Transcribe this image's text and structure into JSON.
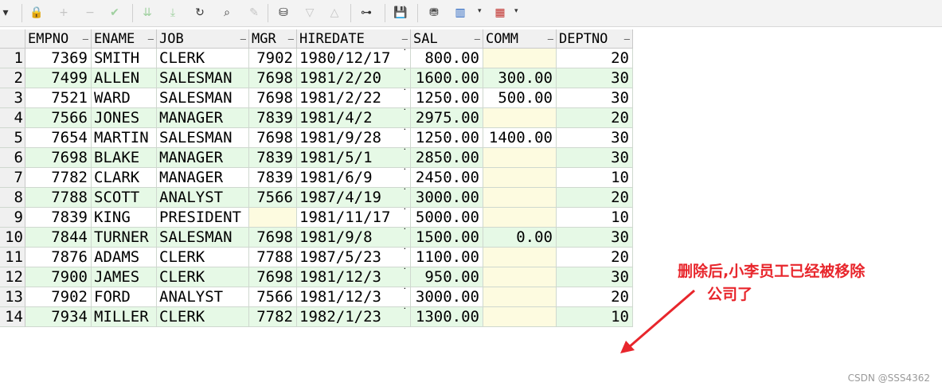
{
  "toolbar": {
    "icons": [
      {
        "name": "dropdown-caret-icon",
        "glyph": "▾",
        "state": "normal"
      },
      {
        "name": "lock-icon",
        "glyph": "🔒",
        "state": "normal"
      },
      {
        "name": "add-record-icon",
        "glyph": "+",
        "state": "disabled"
      },
      {
        "name": "delete-record-icon",
        "glyph": "−",
        "state": "disabled"
      },
      {
        "name": "post-changes-icon",
        "glyph": "✔",
        "state": "disabled-green"
      },
      {
        "name": "fetch-next-icon",
        "glyph": "⇊",
        "state": "disabled-green"
      },
      {
        "name": "fetch-last-icon",
        "glyph": "⤓",
        "state": "disabled-green"
      },
      {
        "name": "refresh-icon",
        "glyph": "↻",
        "state": "normal"
      },
      {
        "name": "find-icon",
        "glyph": "⌕",
        "state": "normal"
      },
      {
        "name": "clear-icon",
        "glyph": "✎",
        "state": "disabled"
      },
      {
        "name": "query-by-example-icon",
        "glyph": "⛁",
        "state": "normal"
      },
      {
        "name": "sort-descending-icon",
        "glyph": "▽",
        "state": "disabled"
      },
      {
        "name": "sort-ascending-icon",
        "glyph": "△",
        "state": "disabled"
      },
      {
        "name": "tree-view-icon",
        "glyph": "⊶",
        "state": "normal"
      },
      {
        "name": "save-icon",
        "glyph": "💾",
        "state": "normal"
      },
      {
        "name": "database-icon",
        "glyph": "⛃",
        "state": "normal"
      },
      {
        "name": "chart-icon",
        "glyph": "▥",
        "state": "normal"
      },
      {
        "name": "grid-view-icon",
        "glyph": "▦",
        "state": "normal"
      }
    ],
    "colors": {
      "background": "#f3f3f3",
      "green": "#3a9b3a"
    }
  },
  "grid": {
    "columns": [
      "EMPNO",
      "ENAME",
      "JOB",
      "MGR",
      "HIREDATE",
      "SAL",
      "COMM",
      "DEPTNO"
    ],
    "rows": [
      {
        "n": "1",
        "empno": "7369",
        "ename": "SMITH",
        "job": "CLERK",
        "mgr": "7902",
        "hiredate": "1980/12/17",
        "sal": "800.00",
        "comm": "",
        "deptno": "20"
      },
      {
        "n": "2",
        "empno": "7499",
        "ename": "ALLEN",
        "job": "SALESMAN",
        "mgr": "7698",
        "hiredate": "1981/2/20",
        "sal": "1600.00",
        "comm": "300.00",
        "deptno": "30"
      },
      {
        "n": "3",
        "empno": "7521",
        "ename": "WARD",
        "job": "SALESMAN",
        "mgr": "7698",
        "hiredate": "1981/2/22",
        "sal": "1250.00",
        "comm": "500.00",
        "deptno": "30"
      },
      {
        "n": "4",
        "empno": "7566",
        "ename": "JONES",
        "job": "MANAGER",
        "mgr": "7839",
        "hiredate": "1981/4/2",
        "sal": "2975.00",
        "comm": "",
        "deptno": "20"
      },
      {
        "n": "5",
        "empno": "7654",
        "ename": "MARTIN",
        "job": "SALESMAN",
        "mgr": "7698",
        "hiredate": "1981/9/28",
        "sal": "1250.00",
        "comm": "1400.00",
        "deptno": "30"
      },
      {
        "n": "6",
        "empno": "7698",
        "ename": "BLAKE",
        "job": "MANAGER",
        "mgr": "7839",
        "hiredate": "1981/5/1",
        "sal": "2850.00",
        "comm": "",
        "deptno": "30"
      },
      {
        "n": "7",
        "empno": "7782",
        "ename": "CLARK",
        "job": "MANAGER",
        "mgr": "7839",
        "hiredate": "1981/6/9",
        "sal": "2450.00",
        "comm": "",
        "deptno": "10"
      },
      {
        "n": "8",
        "empno": "7788",
        "ename": "SCOTT",
        "job": "ANALYST",
        "mgr": "7566",
        "hiredate": "1987/4/19",
        "sal": "3000.00",
        "comm": "",
        "deptno": "20"
      },
      {
        "n": "9",
        "empno": "7839",
        "ename": "KING",
        "job": "PRESIDENT",
        "mgr": "",
        "hiredate": "1981/11/17",
        "sal": "5000.00",
        "comm": "",
        "deptno": "10"
      },
      {
        "n": "10",
        "empno": "7844",
        "ename": "TURNER",
        "job": "SALESMAN",
        "mgr": "7698",
        "hiredate": "1981/9/8",
        "sal": "1500.00",
        "comm": "0.00",
        "deptno": "30"
      },
      {
        "n": "11",
        "empno": "7876",
        "ename": "ADAMS",
        "job": "CLERK",
        "mgr": "7788",
        "hiredate": "1987/5/23",
        "sal": "1100.00",
        "comm": "",
        "deptno": "20"
      },
      {
        "n": "12",
        "empno": "7900",
        "ename": "JAMES",
        "job": "CLERK",
        "mgr": "7698",
        "hiredate": "1981/12/3",
        "sal": "950.00",
        "comm": "",
        "deptno": "30"
      },
      {
        "n": "13",
        "empno": "7902",
        "ename": "FORD",
        "job": "ANALYST",
        "mgr": "7566",
        "hiredate": "1981/12/3",
        "sal": "3000.00",
        "comm": "",
        "deptno": "20"
      },
      {
        "n": "14",
        "empno": "7934",
        "ename": "MILLER",
        "job": "CLERK",
        "mgr": "7782",
        "hiredate": "1982/1/23",
        "sal": "1300.00",
        "comm": "",
        "deptno": "10"
      }
    ],
    "colors": {
      "row_even": "#e6f9e6",
      "row_odd": "#ffffff",
      "empty_null": "#fdfbe0",
      "header": "#f0f0f0"
    }
  },
  "annotation": {
    "line1": "删除后,小李员工已经被移除",
    "line2": "公司了",
    "color": "#e8262c"
  },
  "watermark": "CSDN @SSS4362"
}
